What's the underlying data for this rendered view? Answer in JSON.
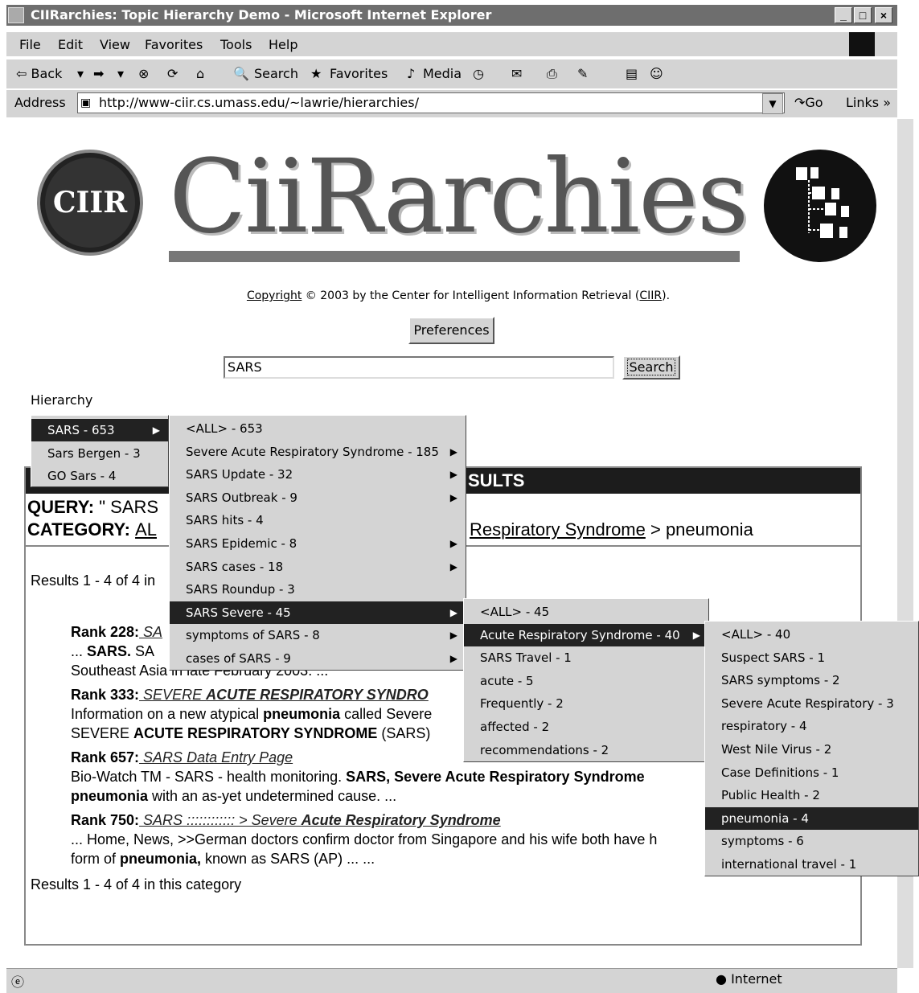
{
  "window": {
    "title": "CIIRarchies: Topic Hierarchy Demo - Microsoft Internet Explorer",
    "minimize": "_",
    "maximize": "□",
    "close": "×"
  },
  "menubar": [
    "File",
    "Edit",
    "View",
    "Favorites",
    "Tools",
    "Help"
  ],
  "toolbar": {
    "back": "⇦ Back",
    "search": "Search",
    "favorites": "Favorites",
    "media": "Media"
  },
  "addressbar": {
    "label": "Address",
    "url": "http://www-ciir.cs.umass.edu/~lawrie/hierarchies/",
    "go": "Go",
    "links": "Links"
  },
  "page": {
    "logo_text": "CIIR",
    "site_title": "CiiRarchies",
    "copyright": {
      "link": "Copyright",
      "middle": " © 2003 by the Center for Intelligent Information Retrieval (",
      "ciir": "CIIR",
      "end": ")."
    },
    "preferences_label": "Preferences",
    "search_value": "SARS",
    "search_label": "Search",
    "hierarchy_label": "Hierarchy"
  },
  "results": {
    "header": "SULTS",
    "query_label": "QUERY:",
    "query_value": "\" SARS",
    "category_label": "CATEGORY:",
    "category_value": "AL",
    "category_path_link": "Respiratory Syndrome",
    "category_path_end": " > pneumonia",
    "count_top": "Results 1 - 4 of 4 in",
    "count_bottom": "Results 1 - 4 of 4 in this category",
    "items": [
      {
        "rank": "Rank 228:",
        "link": " SA",
        "line1_pre": "... ",
        "line1_bold": "SARS.",
        "line1_post": " SA",
        "line2": "Southeast Asia in late February 2003. ..."
      },
      {
        "rank": "Rank 333:",
        "link_pre": " SEVERE ",
        "link_bold": "ACUTE RESPIRATORY SYNDRO",
        "line1_pre": "Information on a new atypical ",
        "line1_bold": "pneumonia",
        "line1_post": " called Severe",
        "line2_pre": "SEVERE ",
        "line2_bold": "ACUTE RESPIRATORY SYNDROME",
        "line2_post": " (SARS)"
      },
      {
        "rank": "Rank 657:",
        "link": " SARS Data Entry Page",
        "line1_pre": "Bio-Watch TM - SARS - health monitoring. ",
        "line1_bold": "SARS, Severe Acute Respiratory Syndrome",
        "line2_bold": "pneumonia",
        "line2_post": " with an as-yet undetermined cause. ..."
      },
      {
        "rank": "Rank 750:",
        "link_pre": " SARS :::::::::::: > Severe ",
        "link_bold": "Acute Respiratory Syndrome",
        "line1": "... Home, News, >>German doctors confirm doctor from Singapore and his wife both have h",
        "line2_pre": "form of ",
        "line2_bold": "pneumonia,",
        "line2_post": " known as SARS (AP) ... ..."
      }
    ]
  },
  "menus": {
    "level1": [
      {
        "label": "SARS - 653",
        "selected": true,
        "submenu": true
      },
      {
        "label": "Sars Bergen - 3",
        "selected": false,
        "submenu": false
      },
      {
        "label": "GO Sars - 4",
        "selected": false,
        "submenu": false
      }
    ],
    "level2": [
      {
        "label": "<ALL> - 653",
        "selected": false,
        "submenu": false
      },
      {
        "label": "Severe Acute Respiratory Syndrome - 185",
        "selected": false,
        "submenu": true
      },
      {
        "label": "SARS Update - 32",
        "selected": false,
        "submenu": true
      },
      {
        "label": "SARS Outbreak - 9",
        "selected": false,
        "submenu": true
      },
      {
        "label": "SARS hits - 4",
        "selected": false,
        "submenu": false
      },
      {
        "label": "SARS Epidemic - 8",
        "selected": false,
        "submenu": true
      },
      {
        "label": "SARS cases - 18",
        "selected": false,
        "submenu": true
      },
      {
        "label": "SARS Roundup - 3",
        "selected": false,
        "submenu": false
      },
      {
        "label": "SARS Severe - 45",
        "selected": true,
        "submenu": true
      },
      {
        "label": "symptoms of SARS - 8",
        "selected": false,
        "submenu": true
      },
      {
        "label": "cases of SARS - 9",
        "selected": false,
        "submenu": true
      }
    ],
    "level3": [
      {
        "label": "<ALL> - 45",
        "selected": false,
        "submenu": false
      },
      {
        "label": "Acute Respiratory Syndrome - 40",
        "selected": true,
        "submenu": true
      },
      {
        "label": "SARS Travel - 1",
        "selected": false,
        "submenu": false
      },
      {
        "label": "acute - 5",
        "selected": false,
        "submenu": false
      },
      {
        "label": "Frequently - 2",
        "selected": false,
        "submenu": false
      },
      {
        "label": "affected - 2",
        "selected": false,
        "submenu": false
      },
      {
        "label": "recommendations - 2",
        "selected": false,
        "submenu": false
      }
    ],
    "level4": [
      {
        "label": "<ALL> - 40",
        "selected": false,
        "submenu": false
      },
      {
        "label": "Suspect SARS - 1",
        "selected": false,
        "submenu": false
      },
      {
        "label": "SARS symptoms - 2",
        "selected": false,
        "submenu": false
      },
      {
        "label": "Severe Acute Respiratory - 3",
        "selected": false,
        "submenu": false
      },
      {
        "label": "respiratory - 4",
        "selected": false,
        "submenu": false
      },
      {
        "label": "West Nile Virus - 2",
        "selected": false,
        "submenu": false
      },
      {
        "label": "Case Definitions - 1",
        "selected": false,
        "submenu": false
      },
      {
        "label": "Public Health - 2",
        "selected": false,
        "submenu": false
      },
      {
        "label": "pneumonia - 4",
        "selected": true,
        "submenu": false
      },
      {
        "label": "symptoms - 6",
        "selected": false,
        "submenu": false
      },
      {
        "label": "international travel - 1",
        "selected": false,
        "submenu": false
      }
    ]
  },
  "statusbar": {
    "zone": "Internet"
  }
}
